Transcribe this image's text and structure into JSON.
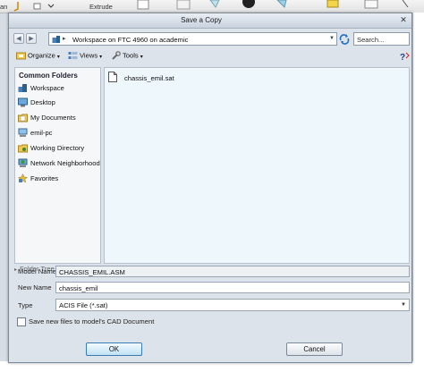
{
  "background_app": {
    "toolbar_text_left": "an",
    "toolbar_text_extrude": "Extrude"
  },
  "dialog": {
    "title": "Save a Copy",
    "close_glyph": "✕"
  },
  "nav": {
    "back_glyph": "◀",
    "forward_glyph": "▶",
    "path_arrow": "▸",
    "path": "Workspace on FTC 4960 on academic",
    "path_dropdown_glyph": "▼",
    "search_placeholder": "Search..."
  },
  "toolbar": {
    "organize": "Organize",
    "views": "Views",
    "tools": "Tools",
    "dropdown_glyph": "▾"
  },
  "common_folders": {
    "heading": "Common Folders",
    "items": [
      {
        "label": "Workspace",
        "icon": "workspace-icon"
      },
      {
        "label": "Desktop",
        "icon": "desktop-icon"
      },
      {
        "label": "My Documents",
        "icon": "documents-icon"
      },
      {
        "label": "emil-pc",
        "icon": "computer-icon"
      },
      {
        "label": "Working Directory",
        "icon": "working-directory-icon"
      },
      {
        "label": "Network Neighborhood",
        "icon": "network-icon"
      },
      {
        "label": "Favorites",
        "icon": "favorites-icon"
      }
    ]
  },
  "folder_tree": {
    "label": "Folder Tree",
    "glyph": "▸"
  },
  "files": [
    {
      "name": "chassis_emil.sat",
      "icon": "file-icon"
    }
  ],
  "form": {
    "model_name_label": "Model Name",
    "model_name_value": "CHASSIS_EMIL.ASM",
    "new_name_label": "New Name",
    "new_name_value": "chassis_emil",
    "type_label": "Type",
    "type_value": "ACIS File (*.sat)",
    "type_dropdown_glyph": "▼",
    "checkbox_label": "Save new files to model's CAD Document",
    "checkbox_checked": false
  },
  "buttons": {
    "ok": "OK",
    "cancel": "Cancel"
  },
  "colors": {
    "file_list_bg": "#eef8fc",
    "ok_border": "#3a7cb1"
  }
}
